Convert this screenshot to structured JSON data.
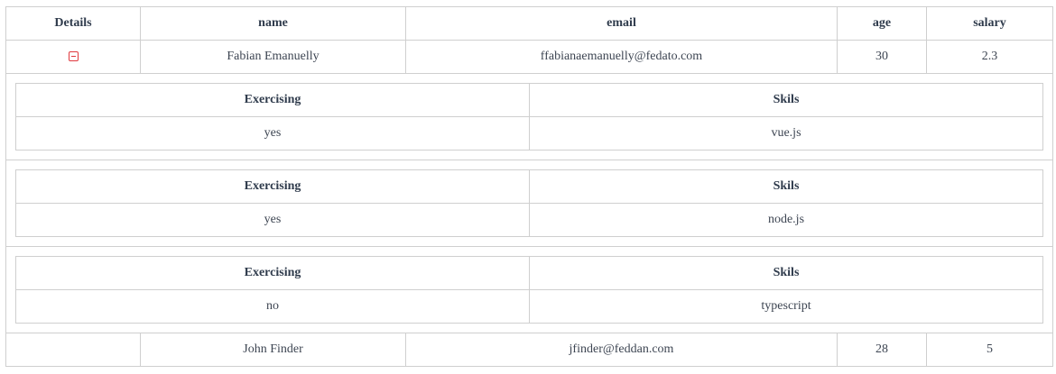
{
  "table": {
    "headers": [
      "Details",
      "name",
      "email",
      "age",
      "salary"
    ],
    "rows": [
      {
        "name": "Fabian Emanuelly",
        "email": "ffabianaemanuelly@fedato.com",
        "age": "30",
        "salary": "2.3",
        "expanded": true,
        "details": [
          {
            "exercising_header": "Exercising",
            "skills_header": "Skils",
            "exercising": "yes",
            "skills": "vue.js"
          },
          {
            "exercising_header": "Exercising",
            "skills_header": "Skils",
            "exercising": "yes",
            "skills": "node.js"
          },
          {
            "exercising_header": "Exercising",
            "skills_header": "Skils",
            "exercising": "no",
            "skills": "typescript"
          }
        ]
      },
      {
        "name": "John Finder",
        "email": "jfinder@feddan.com",
        "age": "28",
        "salary": "5",
        "expanded": false
      }
    ]
  },
  "icons": {
    "collapse": "minus-square-icon",
    "accent": "#e0393e"
  }
}
